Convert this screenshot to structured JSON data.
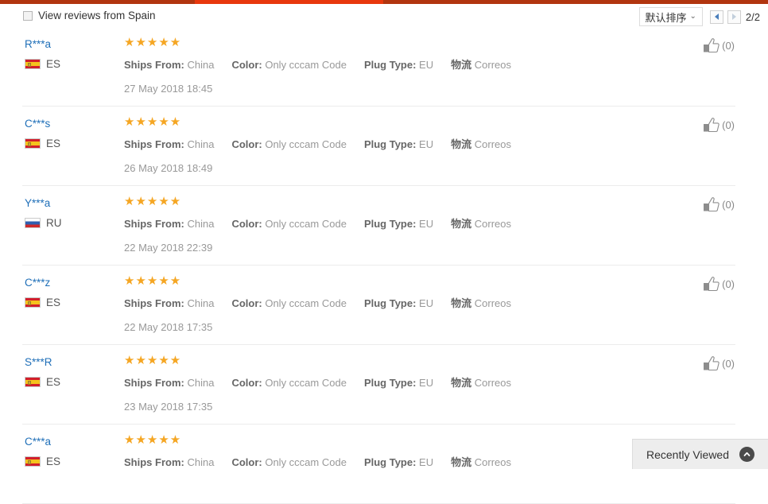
{
  "theme": {
    "accent_bar": "#b1350f",
    "accent_active": "#e8380d",
    "star_color": "#f5a623",
    "link_color": "#1f6fb8"
  },
  "header": {
    "filter_label": "View reviews from Spain",
    "filter_checked": false,
    "sort_label": "默认排序",
    "sort_chevron": "⌄",
    "prev_icon": "triangle-left",
    "next_icon": "triangle-right",
    "page_indicator": "2/2"
  },
  "reviews": [
    {
      "name": "R***a",
      "country_code": "ES",
      "flag": "es",
      "stars": "★★★★★",
      "rating": 5,
      "attributes": [
        {
          "key": "Ships From:",
          "value": "China"
        },
        {
          "key": "Color:",
          "value": "Only cccam Code"
        },
        {
          "key": "Plug Type:",
          "value": "EU"
        },
        {
          "key": "物流",
          "value": "Correos"
        }
      ],
      "date": "27 May 2018 18:45",
      "helpful_count": "(0)"
    },
    {
      "name": "C***s",
      "country_code": "ES",
      "flag": "es",
      "stars": "★★★★★",
      "rating": 5,
      "attributes": [
        {
          "key": "Ships From:",
          "value": "China"
        },
        {
          "key": "Color:",
          "value": "Only cccam Code"
        },
        {
          "key": "Plug Type:",
          "value": "EU"
        },
        {
          "key": "物流",
          "value": "Correos"
        }
      ],
      "date": "26 May 2018 18:49",
      "helpful_count": "(0)"
    },
    {
      "name": "Y***a",
      "country_code": "RU",
      "flag": "ru",
      "stars": "★★★★★",
      "rating": 5,
      "attributes": [
        {
          "key": "Ships From:",
          "value": "China"
        },
        {
          "key": "Color:",
          "value": "Only cccam Code"
        },
        {
          "key": "Plug Type:",
          "value": "EU"
        },
        {
          "key": "物流",
          "value": "Correos"
        }
      ],
      "date": "22 May 2018 22:39",
      "helpful_count": "(0)"
    },
    {
      "name": "C***z",
      "country_code": "ES",
      "flag": "es",
      "stars": "★★★★★",
      "rating": 5,
      "attributes": [
        {
          "key": "Ships From:",
          "value": "China"
        },
        {
          "key": "Color:",
          "value": "Only cccam Code"
        },
        {
          "key": "Plug Type:",
          "value": "EU"
        },
        {
          "key": "物流",
          "value": "Correos"
        }
      ],
      "date": "22 May 2018 17:35",
      "helpful_count": "(0)"
    },
    {
      "name": "S***R",
      "country_code": "ES",
      "flag": "es",
      "stars": "★★★★★",
      "rating": 5,
      "attributes": [
        {
          "key": "Ships From:",
          "value": "China"
        },
        {
          "key": "Color:",
          "value": "Only cccam Code"
        },
        {
          "key": "Plug Type:",
          "value": "EU"
        },
        {
          "key": "物流",
          "value": "Correos"
        }
      ],
      "date": "23 May 2018 17:35",
      "helpful_count": "(0)"
    },
    {
      "name": "C***a",
      "country_code": "ES",
      "flag": "es",
      "stars": "★★★★★",
      "rating": 5,
      "attributes": [
        {
          "key": "Ships From:",
          "value": "China"
        },
        {
          "key": "Color:",
          "value": "Only cccam Code"
        },
        {
          "key": "Plug Type:",
          "value": "EU"
        },
        {
          "key": "物流",
          "value": "Correos"
        }
      ],
      "date": "",
      "helpful_count": ""
    }
  ],
  "recently_viewed": {
    "label": "Recently Viewed",
    "collapse_icon": "chevron-up-icon"
  }
}
